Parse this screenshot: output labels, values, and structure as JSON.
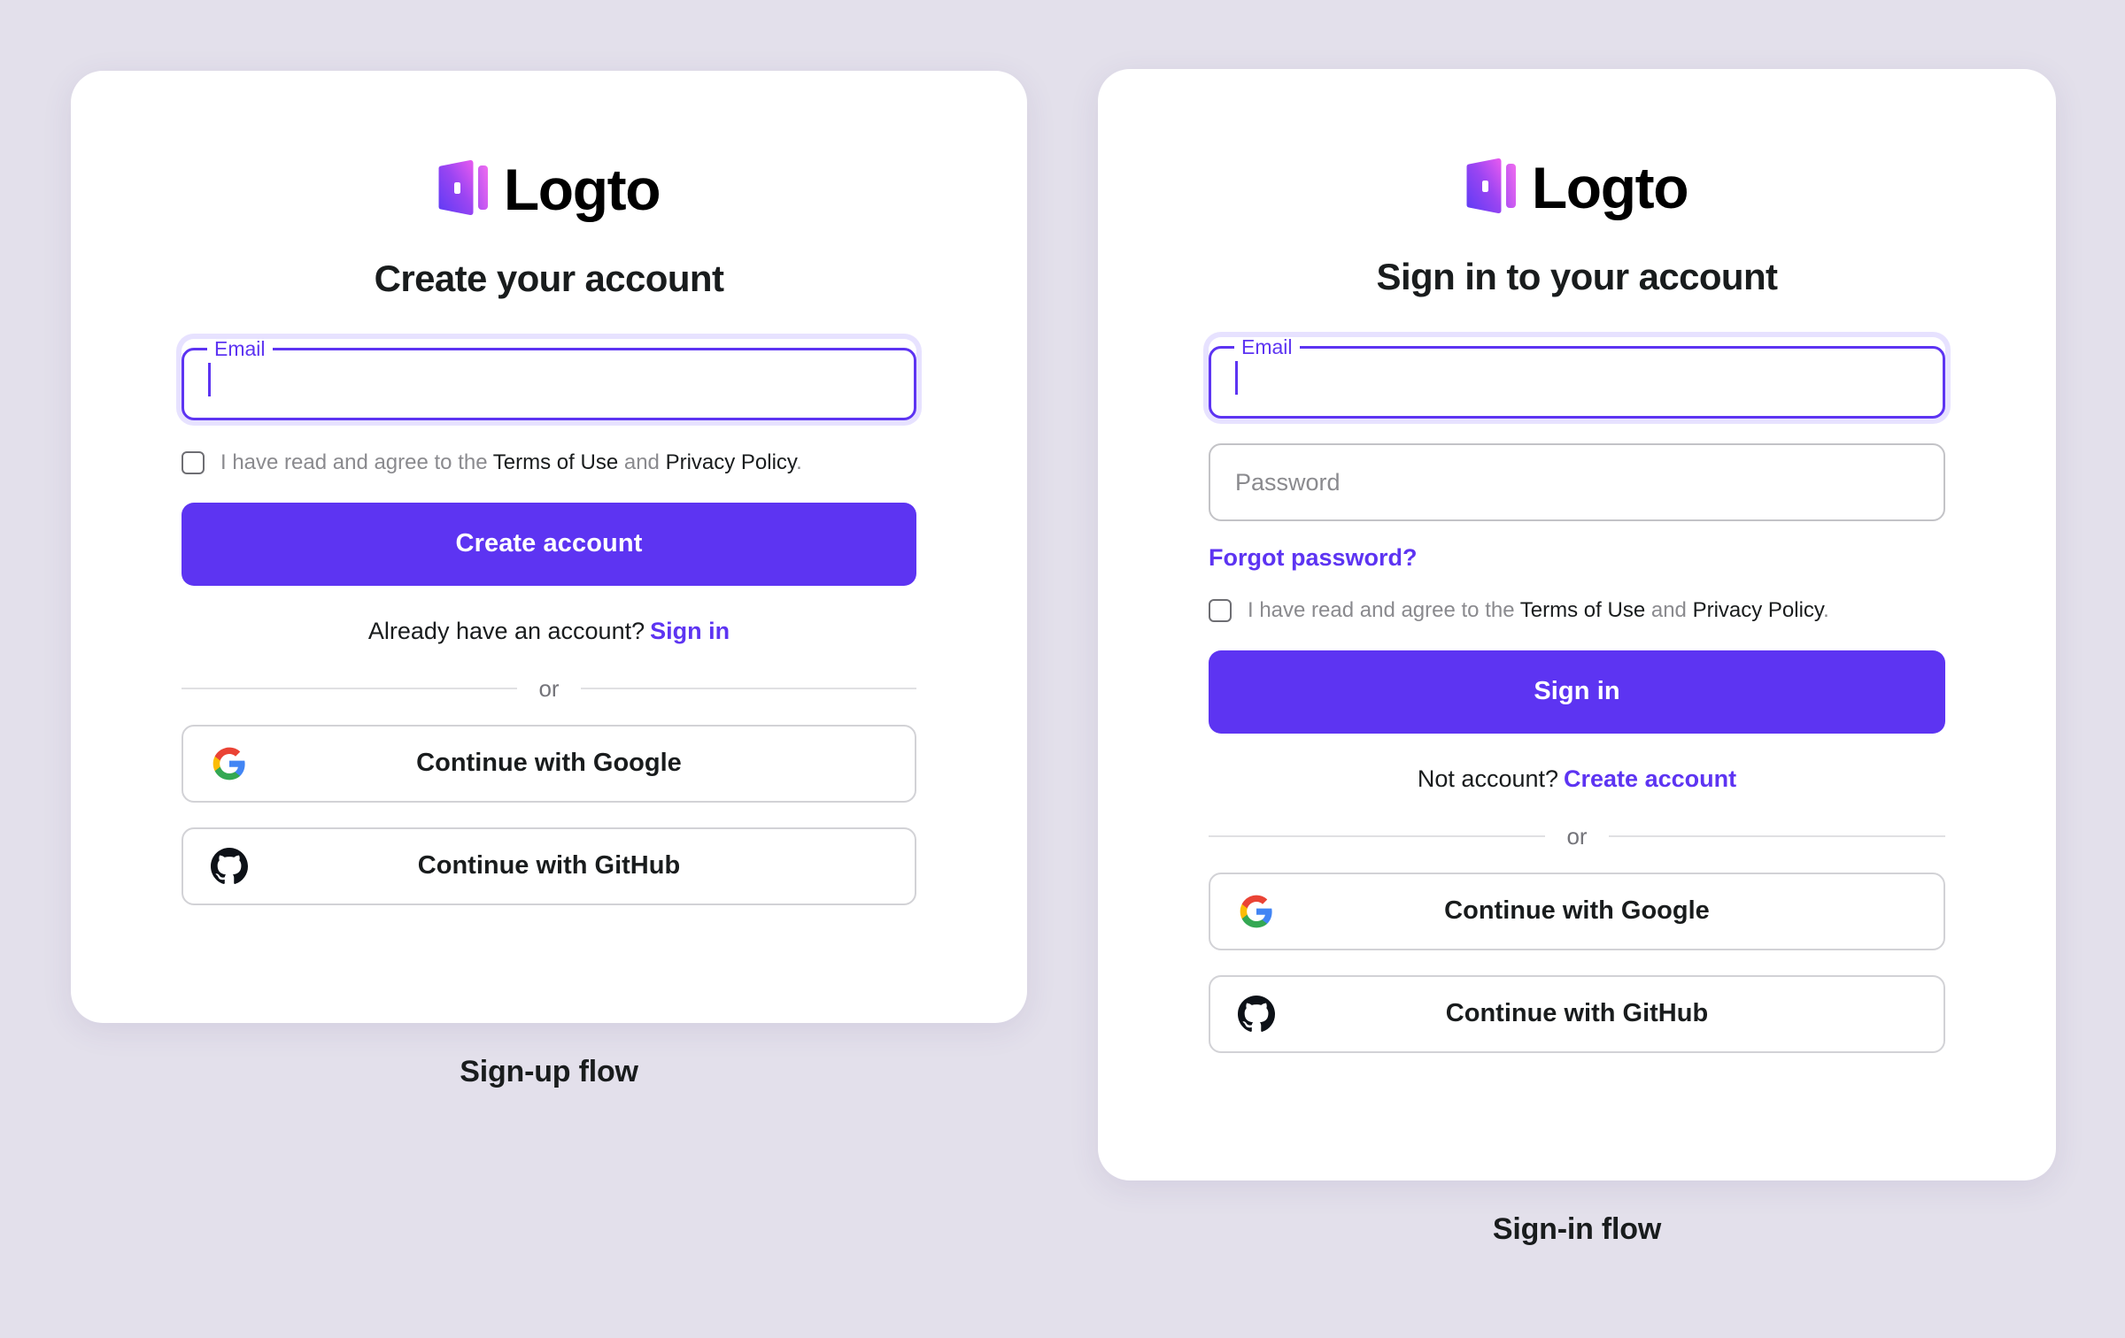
{
  "brand": {
    "name": "Logto",
    "accent": "#5D34F2",
    "logo_icon": "logto-door-icon",
    "logo_gradient_from": "#6B3AF0",
    "logo_gradient_to": "#E95BF0"
  },
  "background_color": "#E3E0EB",
  "captions": {
    "signup": "Sign-up flow",
    "signin": "Sign-in flow"
  },
  "shared": {
    "terms_prefix": "I have read and agree to the ",
    "terms_of_use": "Terms of Use",
    "terms_and": " and ",
    "privacy_policy": "Privacy Policy",
    "terms_suffix": ".",
    "divider_label": "or",
    "google_label": "Continue with Google",
    "github_label": "Continue with GitHub",
    "google_icon": "google-icon",
    "github_icon": "github-icon",
    "checkbox_checked": false
  },
  "signup": {
    "heading": "Create your account",
    "email_label": "Email",
    "email_value": "",
    "email_placeholder": "",
    "submit_label": "Create account",
    "switch_prompt": "Already have an account?",
    "switch_link": "Sign in"
  },
  "signin": {
    "heading": "Sign in to your account",
    "email_label": "Email",
    "email_value": "",
    "email_placeholder": "",
    "password_placeholder": "Password",
    "password_value": "",
    "forgot_label": "Forgot password?",
    "submit_label": "Sign in",
    "switch_prompt": "Not account?",
    "switch_link": "Create account"
  }
}
